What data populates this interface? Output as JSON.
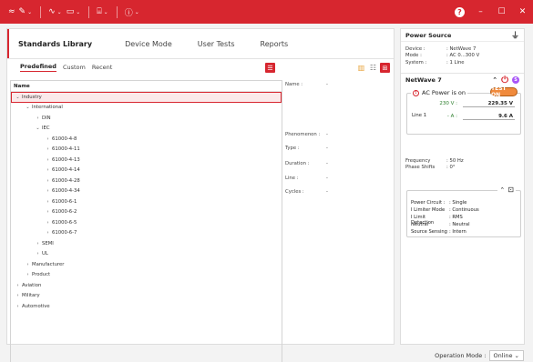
{
  "titlebar": {
    "window_controls": {
      "minimize": "–",
      "maximize": "☐",
      "close": "✕"
    },
    "help": "?",
    "colors": {
      "bar": "#d7262f"
    }
  },
  "tabs": [
    "Standards Library",
    "Device Mode",
    "User Tests",
    "Reports"
  ],
  "subtabs": [
    "Predefined",
    "Custom",
    "Recent"
  ],
  "tree": {
    "header": "Name",
    "nodes": [
      {
        "label": "Industry",
        "indent": 0,
        "expanded": true,
        "selected": true
      },
      {
        "label": "International",
        "indent": 1,
        "expanded": true
      },
      {
        "label": "DIN",
        "indent": 2,
        "expanded": false
      },
      {
        "label": "IEC",
        "indent": 2,
        "expanded": true
      },
      {
        "label": "61000-4-8",
        "indent": 3,
        "expanded": false
      },
      {
        "label": "61000-4-11",
        "indent": 3,
        "expanded": false
      },
      {
        "label": "61000-4-13",
        "indent": 3,
        "expanded": false
      },
      {
        "label": "61000-4-14",
        "indent": 3,
        "expanded": false
      },
      {
        "label": "61000-4-28",
        "indent": 3,
        "expanded": false
      },
      {
        "label": "61000-4-34",
        "indent": 3,
        "expanded": false
      },
      {
        "label": "61000-6-1",
        "indent": 3,
        "expanded": false
      },
      {
        "label": "61000-6-2",
        "indent": 3,
        "expanded": false
      },
      {
        "label": "61000-6-5",
        "indent": 3,
        "expanded": false
      },
      {
        "label": "61000-6-7",
        "indent": 3,
        "expanded": false
      },
      {
        "label": "SEMI",
        "indent": 2,
        "expanded": false
      },
      {
        "label": "UL",
        "indent": 2,
        "expanded": false
      },
      {
        "label": "Manufacturer",
        "indent": 1,
        "expanded": false
      },
      {
        "label": "Product",
        "indent": 1,
        "expanded": false
      },
      {
        "label": "Aviation",
        "indent": 0,
        "expanded": false
      },
      {
        "label": "Military",
        "indent": 0,
        "expanded": false
      },
      {
        "label": "Automotive",
        "indent": 0,
        "expanded": false
      }
    ]
  },
  "details": [
    {
      "key": "Name :",
      "value": "-"
    },
    {
      "key": "Phenomenon :",
      "value": "-"
    },
    {
      "key": "Type :",
      "value": "-"
    },
    {
      "key": "Duration :",
      "value": "-"
    },
    {
      "key": "Line :",
      "value": "-"
    },
    {
      "key": "Cycles :",
      "value": "-"
    }
  ],
  "power_source": {
    "title": "Power Source",
    "rows": [
      {
        "key": "Device :",
        "value": ": NetWave 7"
      },
      {
        "key": "Mode :",
        "value": ": AC 0...300 V"
      },
      {
        "key": "System :",
        "value": ": 1 Line"
      }
    ]
  },
  "netwave": {
    "title": "NetWave 7",
    "badge": "S",
    "ac_label": "AC Power is on",
    "test_on": "TEST ON",
    "line_label": "Line 1",
    "voltage_unit": "230 V :",
    "voltage_value": "229.35 V",
    "current_unit": "- A :",
    "current_value": "9.6 A",
    "freq_rows": [
      {
        "key": "Frequency",
        "value": ": 50 Hz"
      },
      {
        "key": "Phase Shifts",
        "value": ": 0°"
      }
    ],
    "pc_rows": [
      {
        "key": "Power Circuit :",
        "value": ": Single"
      },
      {
        "key": "I Limiter Mode",
        "value": ": Continuous"
      },
      {
        "key": "I Limit Detection",
        "value": ": RMS"
      },
      {
        "key": "Neutral",
        "value": ": Neutral"
      },
      {
        "key": "Source Sensing",
        "value": ": Intern"
      }
    ]
  },
  "status": {
    "label": "Operation Mode :",
    "value": "Online"
  }
}
